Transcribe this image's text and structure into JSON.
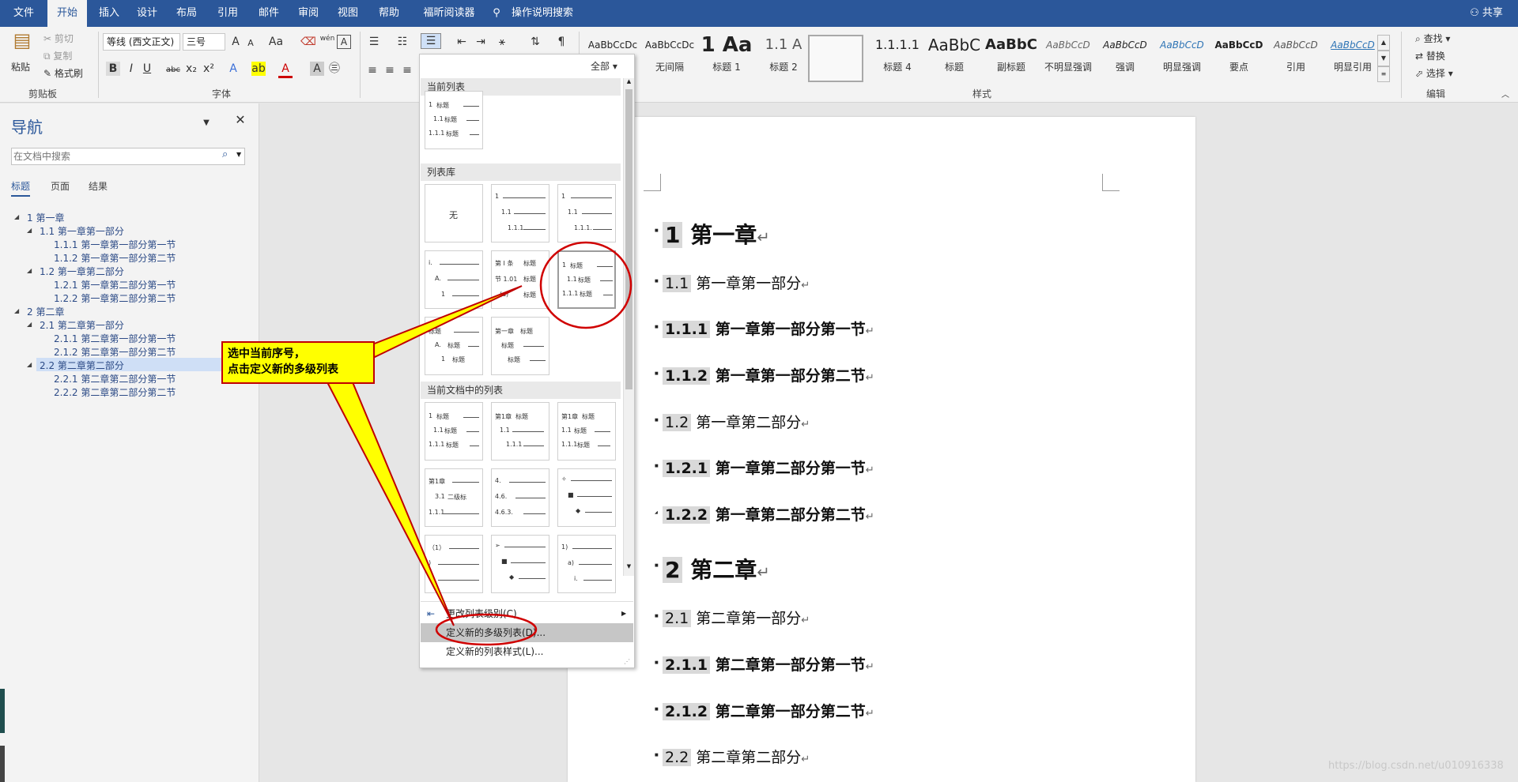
{
  "menu": {
    "tabs": [
      "文件",
      "开始",
      "插入",
      "设计",
      "布局",
      "引用",
      "邮件",
      "审阅",
      "视图",
      "帮助",
      "福昕阅读器"
    ],
    "tell_me": "操作说明搜索",
    "share": "共享"
  },
  "ribbon": {
    "clipboard": {
      "paste": "粘贴",
      "cut": "剪切",
      "copy": "复制",
      "format_painter": "格式刷",
      "label": "剪贴板"
    },
    "font": {
      "name": "等线 (西文正文)",
      "size": "三号",
      "label": "字体",
      "wen": "wén"
    },
    "styles": {
      "label": "样式",
      "items": [
        {
          "pv": "AaBbCcDc",
          "nm": "正文"
        },
        {
          "pv": "AaBbCcDc",
          "nm": "无间隔"
        },
        {
          "pv": "1 Aa",
          "nm": "标题 1"
        },
        {
          "pv": "1.1 A",
          "nm": "标题 2"
        },
        {
          "pv": "1.1.1",
          "nm": "标题 3"
        },
        {
          "pv": "1.1.1.1",
          "nm": "标题 4"
        },
        {
          "pv": "AaBbC",
          "nm": "标题"
        },
        {
          "pv": "AaBbC",
          "nm": "副标题"
        },
        {
          "pv": "AaBbCcD",
          "nm": "不明显强调"
        },
        {
          "pv": "AaBbCcD",
          "nm": "强调"
        },
        {
          "pv": "AaBbCcD",
          "nm": "明显强调"
        },
        {
          "pv": "AaBbCcD",
          "nm": "要点"
        },
        {
          "pv": "AaBbCcD",
          "nm": "引用"
        },
        {
          "pv": "AaBbCcD",
          "nm": "明显引用"
        }
      ]
    },
    "editing": {
      "find": "查找",
      "replace": "替换",
      "select": "选择",
      "label": "编辑"
    }
  },
  "nav": {
    "title": "导航",
    "search_placeholder": "在文档中搜索",
    "tabs": [
      "标题",
      "页面",
      "结果"
    ],
    "tree": [
      "1 第一章",
      "1.1 第一章第一部分",
      "1.1.1 第一章第一部分第一节",
      "1.1.2 第一章第一部分第二节",
      "1.2 第一章第二部分",
      "1.2.1 第一章第二部分第一节",
      "1.2.2 第一章第二部分第二节",
      "2 第二章",
      "2.1 第二章第一部分",
      "2.1.1 第二章第一部分第一节",
      "2.1.2 第二章第一部分第二节",
      "2.2 第二章第二部分",
      "2.2.1 第二章第二部分第一节",
      "2.2.2 第二章第二部分第二节"
    ]
  },
  "document": {
    "headings": [
      {
        "num": "1",
        "text": "第一章"
      },
      {
        "num": "1.1",
        "text": "第一章第一部分"
      },
      {
        "num": "1.1.1",
        "text": "第一章第一部分第一节"
      },
      {
        "num": "1.1.2",
        "text": "第一章第一部分第二节"
      },
      {
        "num": "1.2",
        "text": "第一章第二部分"
      },
      {
        "num": "1.2.1",
        "text": "第一章第二部分第一节"
      },
      {
        "num": "1.2.2",
        "text": "第一章第二部分第二节"
      },
      {
        "num": "2",
        "text": "第二章"
      },
      {
        "num": "2.1",
        "text": "第二章第一部分"
      },
      {
        "num": "2.1.1",
        "text": "第二章第一部分第一节"
      },
      {
        "num": "2.1.2",
        "text": "第二章第一部分第二节"
      },
      {
        "num": "2.2",
        "text": "第二章第二部分"
      }
    ],
    "para_mark": "↵"
  },
  "dropdown": {
    "filter": "全部",
    "current_list": "当前列表",
    "library": "列表库",
    "in_doc": "当前文档中的列表",
    "none": "无",
    "change_level": "更改列表级别(C)",
    "define_new_list": "定义新的多级列表(D)...",
    "define_new_style": "定义新的列表样式(L)...",
    "label": "标题",
    "label_zhang": "第1章",
    "label_tiao": "第 Ⅰ 条",
    "label_jie": "节 1.01",
    "label_a": "(a)",
    "label_di": "第一章",
    "level_1": "1",
    "level_2": "1.1",
    "level_3": "1.1.1",
    "level_3b": "1.1.1.",
    "level_3c": "3.1",
    "level_4": "4.",
    "level_46": "4.6.",
    "level_463": "4.6.3.",
    "level_i": "i.",
    "level_A": "A.",
    "level_p1": "（1）",
    "level_1p": "1)",
    "level_ap": "a)",
    "label_bianhao": "二级标"
  },
  "callout": {
    "line1": "选中当前序号，",
    "line2": "点击定义新的多级列表"
  },
  "watermark": "https://blog.csdn.net/u010916338"
}
